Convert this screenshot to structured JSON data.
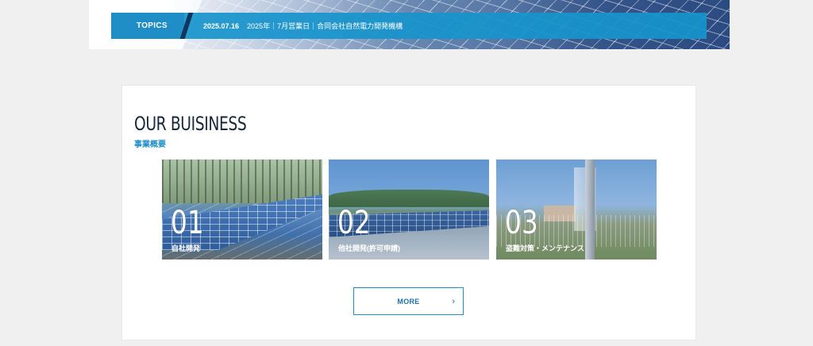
{
  "topics": {
    "label": "TOPICS",
    "date": "2025.07.16",
    "text": "2025年｜7月営業日｜合同会社自然電力開発機構"
  },
  "business": {
    "title": "OUR BUISINESS",
    "subtitle": "事業概要",
    "cards": [
      {
        "number": "01",
        "label": "自社開発"
      },
      {
        "number": "02",
        "label": "他社開発(許可申請)"
      },
      {
        "number": "03",
        "label": "盗難対策・メンテナンス"
      }
    ],
    "more_label": "MORE",
    "more_icon": "chevron-right-icon"
  },
  "colors": {
    "accent": "#1f8dc6",
    "topics_bar": "#1794cc",
    "title_text": "#16263a",
    "background": "#f0f0f0"
  }
}
